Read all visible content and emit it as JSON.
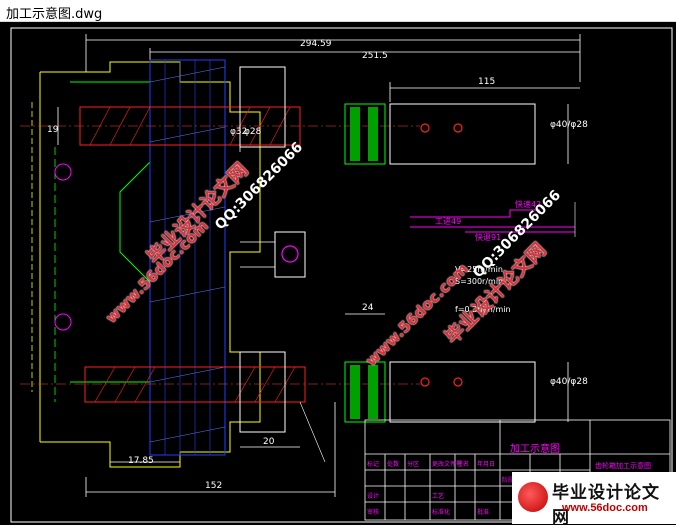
{
  "window": {
    "title": "加工示意图.dwg"
  },
  "dimensions": {
    "d1": "294.59",
    "d2": "251.5",
    "d3": "115",
    "d4": "19",
    "d5": "φ32",
    "d6": "φ28",
    "d7": "φ40/φ28",
    "d8": "φ40/φ28",
    "d9": "24",
    "d10": "20",
    "d11": "17.85",
    "d12": "152"
  },
  "annotations": {
    "a1": "快速42",
    "a2": "工进49",
    "a3": "快退91",
    "a4": "V=25m/min",
    "a5": "S=300r/min",
    "a6": "f=0.2mm/min"
  },
  "title_block": {
    "drawing_title": "加工示意图",
    "part_name": "齿轮箱加工示意图",
    "cells": [
      "标记",
      "处数",
      "分区",
      "更改文件号",
      "签名",
      "年月日",
      "设计",
      "审核",
      "工艺",
      "阶段标记",
      "重量",
      "比例",
      "标准化",
      "批准"
    ]
  },
  "watermarks": {
    "w1": "毕业设计论文网",
    "w2": "www.56doc.com",
    "w3": "QQ:306826066",
    "w4": "www.56doc.com",
    "w5": "毕业设计论文网",
    "w6": "QQ:306826066"
  },
  "badge": {
    "name": "毕业设计论文网",
    "url": "www.56doc.com"
  },
  "colors": {
    "background": "#000000",
    "yellow": "#ffff00",
    "white": "#ffffff",
    "red": "#ff0000",
    "green": "#00ff00",
    "cyan": "#00ffff",
    "magenta": "#ff00ff",
    "blue": "#2040ff"
  }
}
